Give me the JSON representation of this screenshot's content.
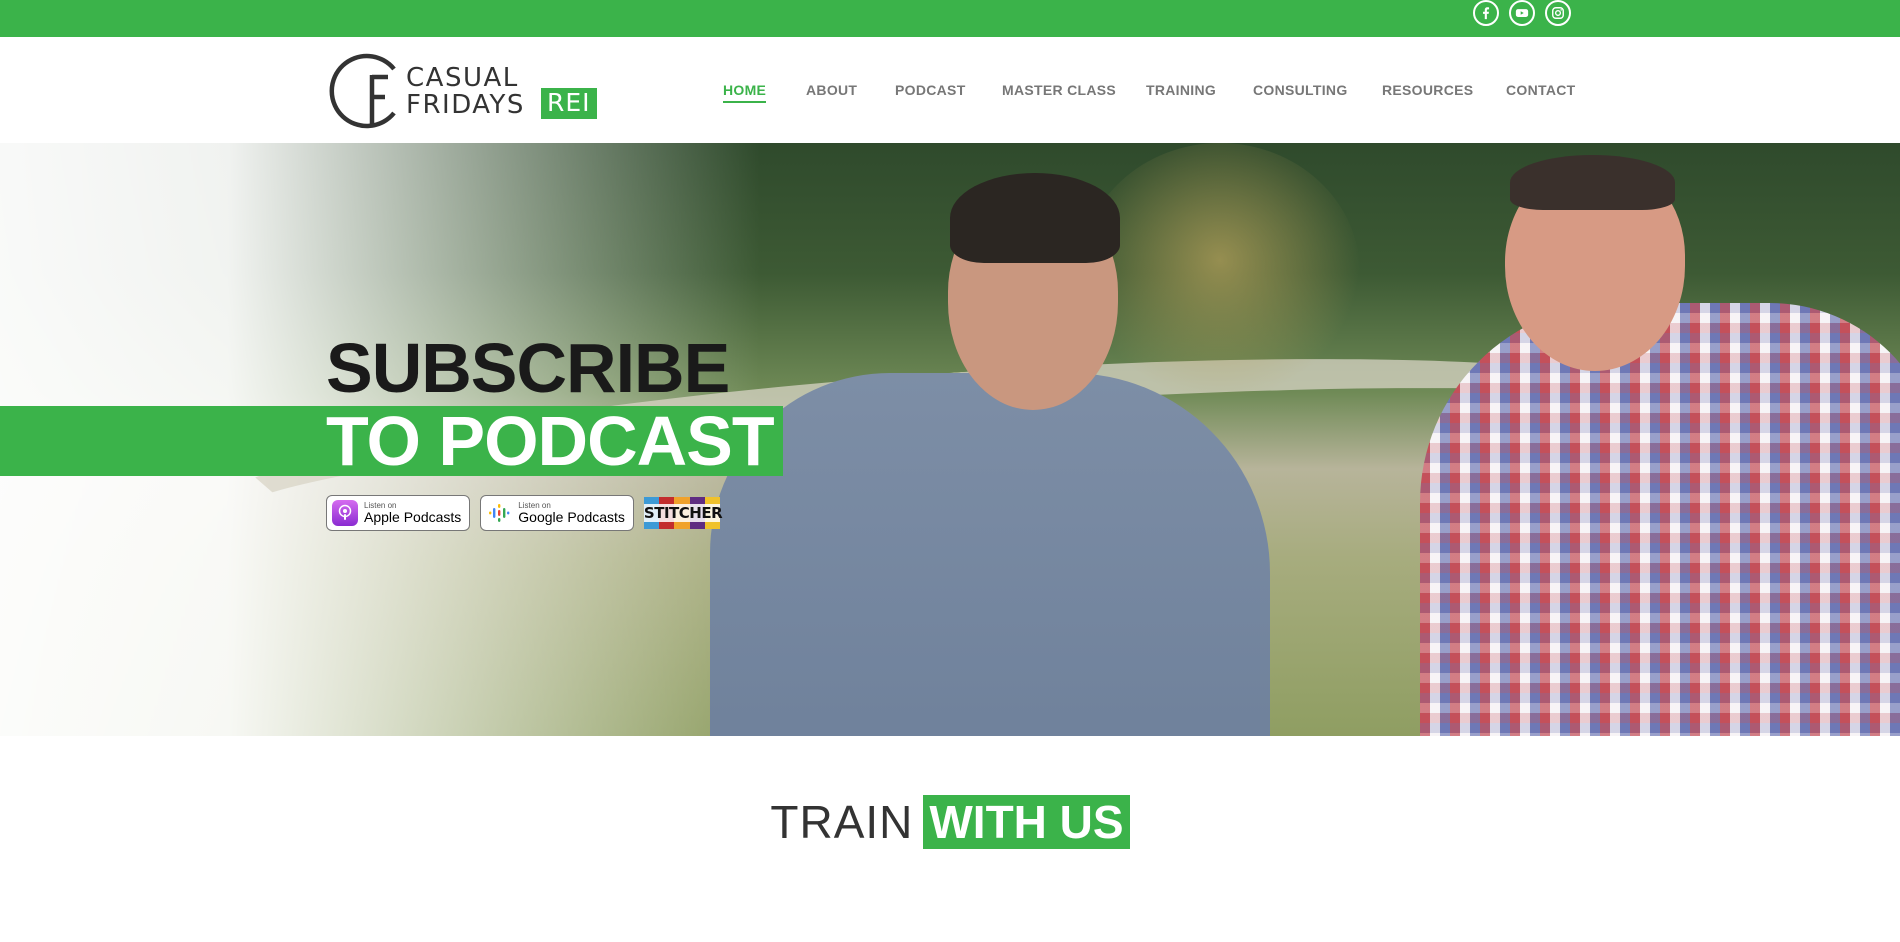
{
  "brand": {
    "accent_color": "#3bb34a",
    "logo_mark": "CF",
    "logo_line1": "CASUAL",
    "logo_line2": "FRIDAYS",
    "logo_rei": "REI"
  },
  "social": [
    {
      "name": "facebook-icon",
      "glyph": "f"
    },
    {
      "name": "youtube-icon",
      "glyph": "▶"
    },
    {
      "name": "instagram-icon",
      "glyph": "◎"
    }
  ],
  "nav": {
    "items": [
      {
        "label": "HOME",
        "active": true
      },
      {
        "label": "ABOUT",
        "active": false
      },
      {
        "label": "PODCAST",
        "active": false
      },
      {
        "label": "MASTER CLASS",
        "active": false
      },
      {
        "label": "TRAINING",
        "active": false
      },
      {
        "label": "CONSULTING",
        "active": false
      },
      {
        "label": "RESOURCES",
        "active": false
      },
      {
        "label": "CONTACT",
        "active": false
      }
    ]
  },
  "hero": {
    "title_line1": "SUBSCRIBE",
    "title_line2": "TO PODCAST",
    "badges": {
      "apple": {
        "small": "Listen on",
        "big": "Apple Podcasts"
      },
      "google": {
        "small": "Listen on",
        "big": "Google Podcasts"
      },
      "stitcher": {
        "label": "STITCHER"
      }
    }
  },
  "train": {
    "light": "TRAIN",
    "bold": "WITH US"
  }
}
